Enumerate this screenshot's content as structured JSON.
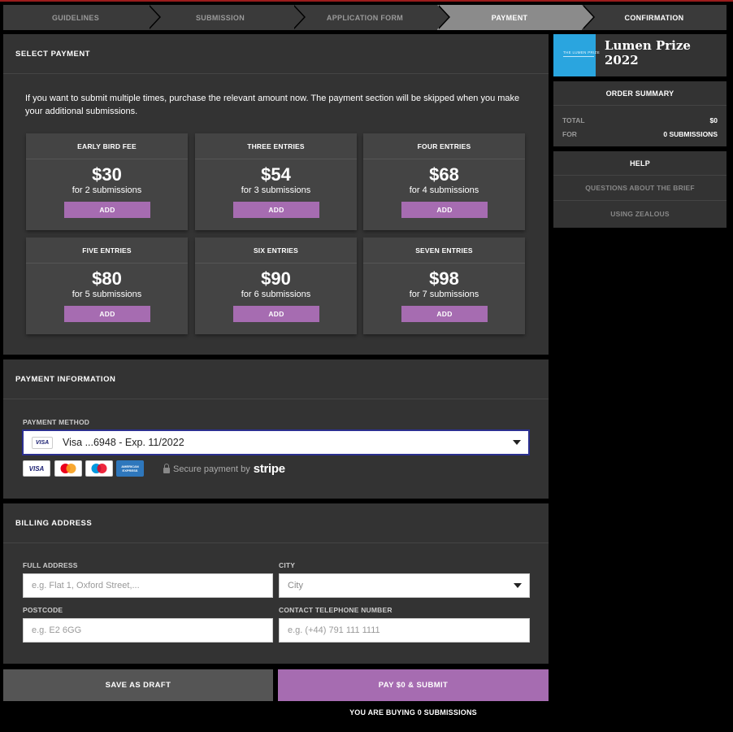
{
  "steps": [
    "GUIDELINES",
    "SUBMISSION",
    "APPLICATION FORM",
    "PAYMENT",
    "CONFIRMATION"
  ],
  "select_payment": {
    "title": "SELECT PAYMENT",
    "intro": "If you want to submit multiple times, purchase the relevant amount now. The payment section will be skipped when you make your additional submissions.",
    "options": [
      {
        "name": "EARLY BIRD FEE",
        "price": "$30",
        "sub": "for 2 submissions",
        "button": "ADD"
      },
      {
        "name": "THREE ENTRIES",
        "price": "$54",
        "sub": "for 3 submissions",
        "button": "ADD"
      },
      {
        "name": "FOUR ENTRIES",
        "price": "$68",
        "sub": "for 4 submissions",
        "button": "ADD"
      },
      {
        "name": "FIVE ENTRIES",
        "price": "$80",
        "sub": "for 5 submissions",
        "button": "ADD"
      },
      {
        "name": "SIX ENTRIES",
        "price": "$90",
        "sub": "for 6 submissions",
        "button": "ADD"
      },
      {
        "name": "SEVEN ENTRIES",
        "price": "$98",
        "sub": "for 7 submissions",
        "button": "ADD"
      }
    ]
  },
  "payment_info": {
    "title": "PAYMENT INFORMATION",
    "method_label": "PAYMENT METHOD",
    "method_value": "Visa ...6948 - Exp. 11/2022",
    "method_badge": "VISA",
    "cards": [
      "VISA",
      "MasterCard",
      "Maestro",
      "AMERICAN EXPRESS"
    ],
    "secure_text": "Secure payment by",
    "stripe": "stripe"
  },
  "billing": {
    "title": "BILLING ADDRESS",
    "address_label": "FULL ADDRESS",
    "address_placeholder": "e.g. Flat 1, Oxford Street,...",
    "city_label": "CITY",
    "city_value": "City",
    "postcode_label": "POSTCODE",
    "postcode_placeholder": "e.g. E2 6GG",
    "phone_label": "CONTACT TELEPHONE NUMBER",
    "phone_placeholder": "e.g. (+44) 791 111 1111"
  },
  "actions": {
    "draft": "SAVE AS DRAFT",
    "pay": "PAY $0 & SUBMIT",
    "buying": "YOU ARE BUYING 0 SUBMISSIONS"
  },
  "sidebar": {
    "prize_title": "Lumen Prize 2022",
    "thumb_text": "THE LUMEN PRIZE",
    "summary_title": "ORDER SUMMARY",
    "total_label": "TOTAL",
    "total_value": "$0",
    "for_label": "FOR",
    "for_value": "0 SUBMISSIONS",
    "help_title": "HELP",
    "help_links": [
      "QUESTIONS ABOUT THE BRIEF",
      "USING ZEALOUS"
    ]
  },
  "colors": {
    "accent": "#a66cb1",
    "panel": "#333333",
    "active_step": "#8b8b8b"
  }
}
